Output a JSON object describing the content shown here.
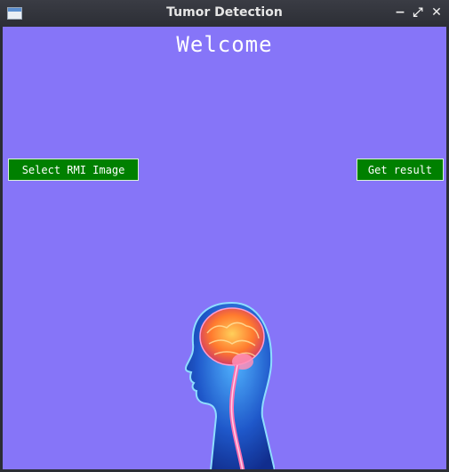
{
  "window": {
    "title": "Tumor Detection",
    "controls": {
      "minimize": "−",
      "maximize": "⤢",
      "close": "✕"
    }
  },
  "main": {
    "heading": "Welcome",
    "select_button": "Select RMI Image",
    "result_button": "Get result",
    "image_icon": "brain-head-illustration"
  },
  "colors": {
    "background": "#8675f8",
    "button": "#008000",
    "titlebar": "#2c2e35"
  }
}
